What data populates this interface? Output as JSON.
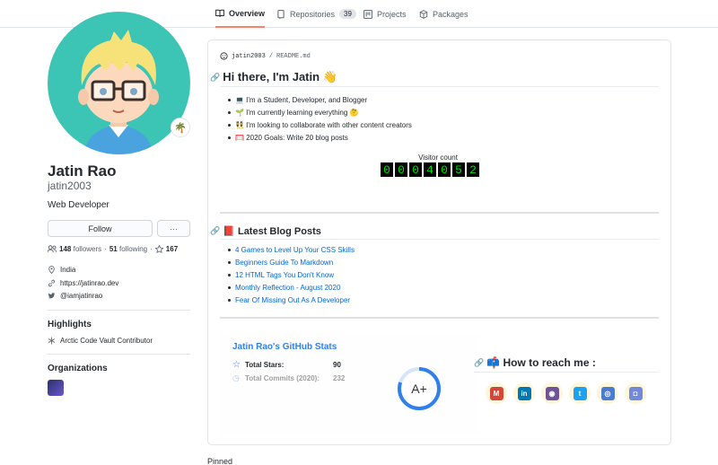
{
  "tabs": [
    {
      "label": "Overview",
      "icon": "book-icon"
    },
    {
      "label": "Repositories",
      "icon": "repo-icon",
      "count": "39"
    },
    {
      "label": "Projects",
      "icon": "project-icon"
    },
    {
      "label": "Packages",
      "icon": "package-icon"
    }
  ],
  "profile": {
    "name": "Jatin Rao",
    "login": "jatin2003",
    "bio": "Web Developer",
    "status_emoji": "🌴",
    "follow_label": "Follow",
    "more_label": "···",
    "followers_count": "148",
    "followers_label": "followers",
    "dot": "·",
    "following_count": "51",
    "following_label": "following",
    "stars_count": "167",
    "location": "India",
    "website": "https://jatinrao.dev",
    "twitter": "@iamjatinrao"
  },
  "highlights": {
    "heading": "Highlights",
    "item": "Arctic Code Vault Contributor"
  },
  "organizations": {
    "heading": "Organizations"
  },
  "readme": {
    "path_user": "jatin2003",
    "path_sep": "/",
    "path_file": "README.md",
    "heading": "Hi there, I'm Jatin 👋",
    "bullets": [
      "💻 I'm a Student, Developer, and Blogger",
      "🌱 I'm currently learning everything 🤔",
      "👯 I'm looking to collaborate with other content creators",
      "🥅 2020 Goals: Write 20 blog posts"
    ],
    "visitor_label": "Visitor count",
    "visitor_digits": [
      "0",
      "0",
      "0",
      "4",
      "0",
      "5",
      "2"
    ],
    "blog_heading": "📕 Latest Blog Posts",
    "blog_posts": [
      "4 Games to Level Up Your CSS Skills",
      "Beginners Guide To Markdown",
      "12 HTML Tags You Don't Know",
      "Monthly Reflection - August 2020",
      "Fear Of Missing Out As A Developer"
    ]
  },
  "stats": {
    "title": "Jatin Rao's GitHub Stats",
    "total_stars_label": "Total Stars:",
    "total_stars_value": "90",
    "total_commits_label": "Total Commits (2020):",
    "total_commits_value": "232",
    "grade": "A+",
    "grade_progress": 0.8,
    "accent": "#2f80ed"
  },
  "reach": {
    "heading": "📫 How to reach me :",
    "links": [
      {
        "icon": "gmail-icon",
        "glyph": "M",
        "color": "#d44638"
      },
      {
        "icon": "linkedin-icon",
        "glyph": "in",
        "color": "#0077b5"
      },
      {
        "icon": "github-icon",
        "glyph": "◉",
        "color": "#6e5494"
      },
      {
        "icon": "twitter-icon",
        "glyph": "t",
        "color": "#1da1f2"
      },
      {
        "icon": "instagram-icon",
        "glyph": "◎",
        "color": "#4a7bd0"
      },
      {
        "icon": "discord-icon",
        "glyph": "◘",
        "color": "#7289da"
      }
    ]
  },
  "pinned_label": "Pinned"
}
